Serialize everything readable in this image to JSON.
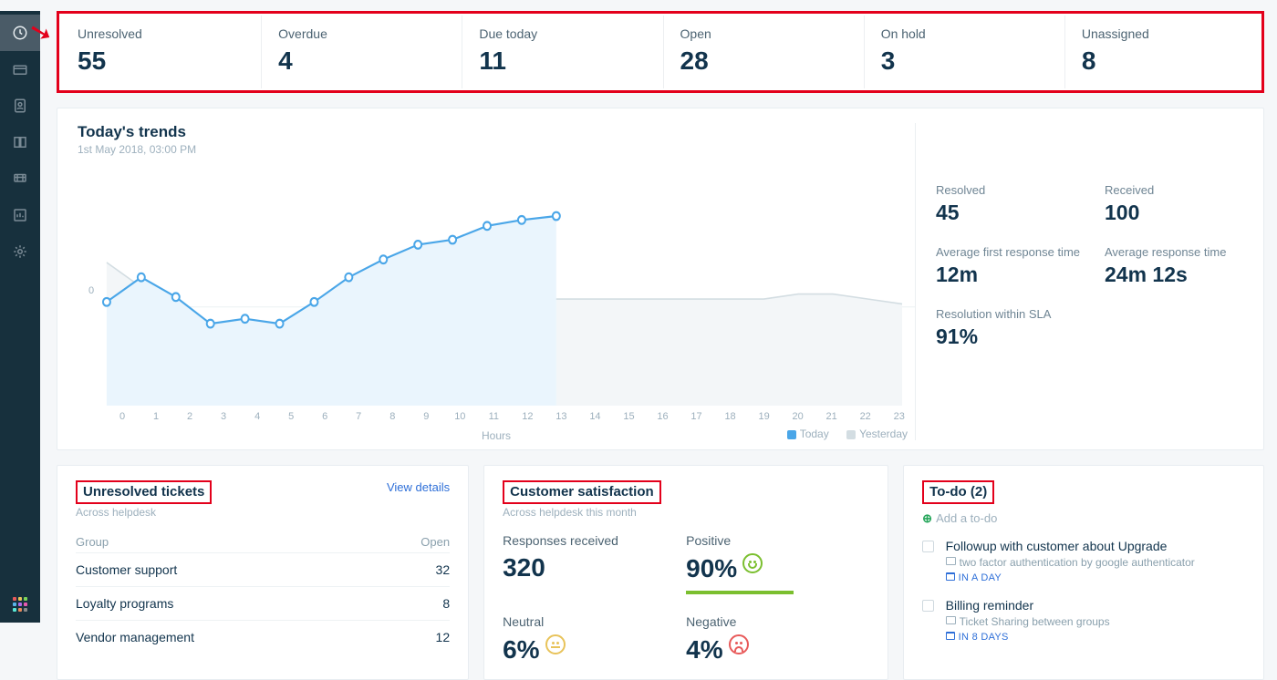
{
  "summary": [
    {
      "label": "Unresolved",
      "value": "55"
    },
    {
      "label": "Overdue",
      "value": "4"
    },
    {
      "label": "Due today",
      "value": "11"
    },
    {
      "label": "Open",
      "value": "28"
    },
    {
      "label": "On hold",
      "value": "3"
    },
    {
      "label": "Unassigned",
      "value": "8"
    }
  ],
  "trends": {
    "title": "Today's trends",
    "subtitle": "1st May 2018, 03:00 PM",
    "axis_title": "Hours",
    "y_tick": "0",
    "legend": {
      "today": "Today",
      "yesterday": "Yesterday"
    },
    "stats": [
      {
        "label": "Resolved",
        "value": "45"
      },
      {
        "label": "Received",
        "value": "100"
      },
      {
        "label": "Average first response time",
        "value": "12m"
      },
      {
        "label": "Average response time",
        "value": "24m 12s"
      },
      {
        "label": "Resolution within SLA",
        "value": "91%"
      }
    ]
  },
  "unresolved": {
    "title": "Unresolved tickets",
    "subtitle": "Across helpdesk",
    "view": "View details",
    "col1": "Group",
    "col2": "Open",
    "rows": [
      {
        "g": "Customer support",
        "n": "32"
      },
      {
        "g": "Loyalty programs",
        "n": "8"
      },
      {
        "g": "Vendor management",
        "n": "12"
      }
    ]
  },
  "csat": {
    "title": "Customer satisfaction",
    "subtitle": "Across helpdesk this month",
    "responses_label": "Responses received",
    "responses_value": "320",
    "positive_label": "Positive",
    "positive_value": "90%",
    "neutral_label": "Neutral",
    "neutral_value": "6%",
    "negative_label": "Negative",
    "negative_value": "4%"
  },
  "todo": {
    "title": "To-do (2)",
    "add": "Add a to-do",
    "items": [
      {
        "title": "Followup with customer about Upgrade",
        "sub": "two factor authentication by google authenticator",
        "due": "IN A DAY"
      },
      {
        "title": "Billing reminder",
        "sub": "Ticket Sharing between groups",
        "due": "IN 8 DAYS"
      }
    ]
  },
  "chart_data": {
    "type": "line",
    "xlabel": "Hours",
    "ylabel": "",
    "x": [
      0,
      1,
      2,
      3,
      4,
      5,
      6,
      7,
      8,
      9,
      10,
      11,
      12,
      13,
      14,
      15,
      16,
      17,
      18,
      19,
      20,
      21,
      22,
      23
    ],
    "series": [
      {
        "name": "Today",
        "color": "#4aa6e8",
        "values": [
          1,
          6,
          2,
          -3,
          -2,
          -3,
          1,
          6,
          9,
          12,
          13,
          16,
          17,
          18
        ]
      },
      {
        "name": "Yesterday",
        "color": "#d3dde2",
        "values": [
          9,
          4,
          -1,
          -5,
          -7,
          -4,
          -2,
          -2,
          -1,
          0,
          0,
          1,
          1,
          2,
          2,
          2,
          2,
          2,
          2,
          2,
          3,
          3,
          2,
          1
        ]
      }
    ],
    "ylim": [
      -10,
      20
    ]
  }
}
